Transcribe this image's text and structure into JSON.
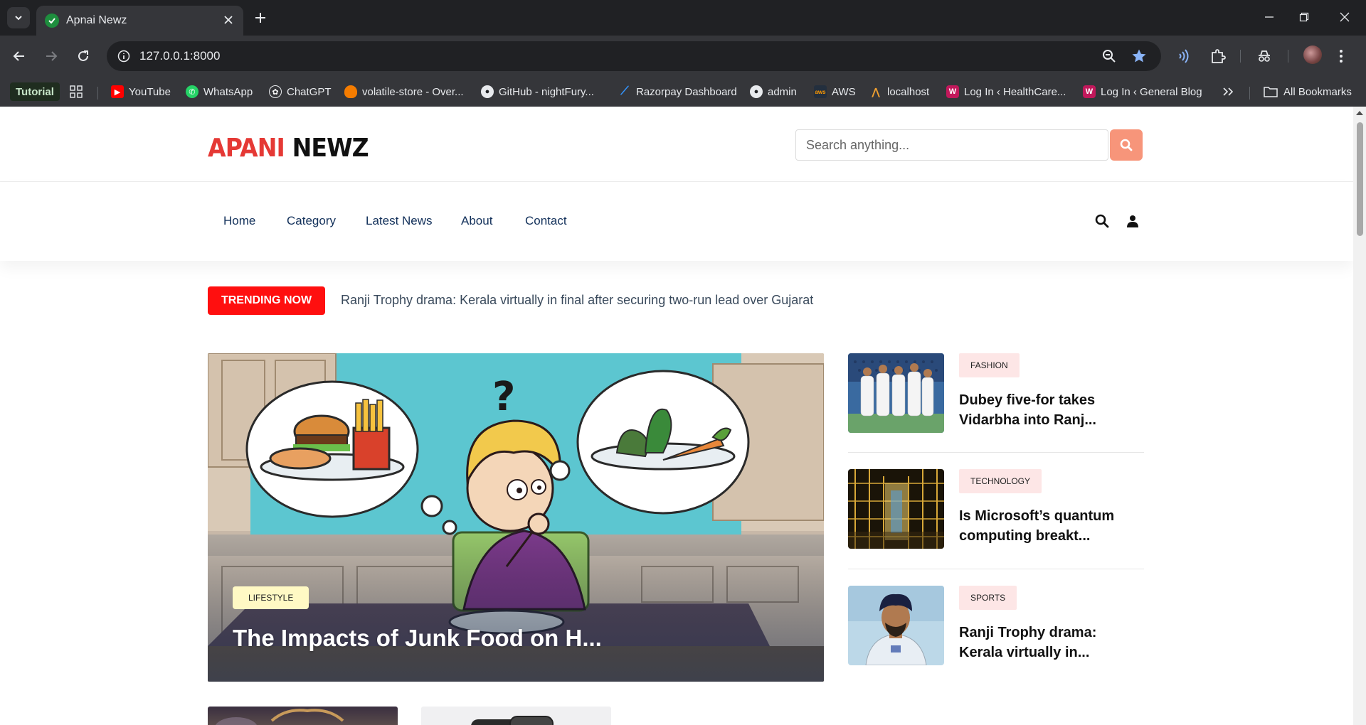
{
  "browser": {
    "tab_title": "Apnai Newz",
    "url": "127.0.0.1:8000",
    "bookmarks": [
      {
        "label": "Tutorial"
      },
      {
        "label": "YouTube"
      },
      {
        "label": "WhatsApp"
      },
      {
        "label": "ChatGPT"
      },
      {
        "label": "volatile-store - Over..."
      },
      {
        "label": "GitHub - nightFury..."
      },
      {
        "label": "Razorpay Dashboard"
      },
      {
        "label": "admin"
      },
      {
        "label": "AWS"
      },
      {
        "label": "localhost"
      },
      {
        "label": "Log In ‹ HealthCare..."
      },
      {
        "label": "Log In ‹ General Blog"
      }
    ],
    "all_bookmarks": "All Bookmarks"
  },
  "site": {
    "logo_part1": "APANI",
    "logo_part2": "NEWZ",
    "search_placeholder": "Search anything...",
    "nav": [
      "Home",
      "Category",
      "Latest News",
      "About",
      "Contact"
    ]
  },
  "trending": {
    "label": "TRENDING NOW",
    "headline": "Ranji Trophy drama: Kerala virtually in final after securing two-run lead over Gujarat"
  },
  "hero": {
    "category": "LIFESTYLE",
    "title": "The Impacts of Junk Food on H..."
  },
  "side_articles": [
    {
      "category": "FASHION",
      "title": "Dubey five-for takes Vidarbha into Ranj..."
    },
    {
      "category": "TECHNOLOGY",
      "title": "Is Microsoft’s quantum computing breakt..."
    },
    {
      "category": "SPORTS",
      "title": "Ranji Trophy drama: Kerala virtually in..."
    }
  ]
}
